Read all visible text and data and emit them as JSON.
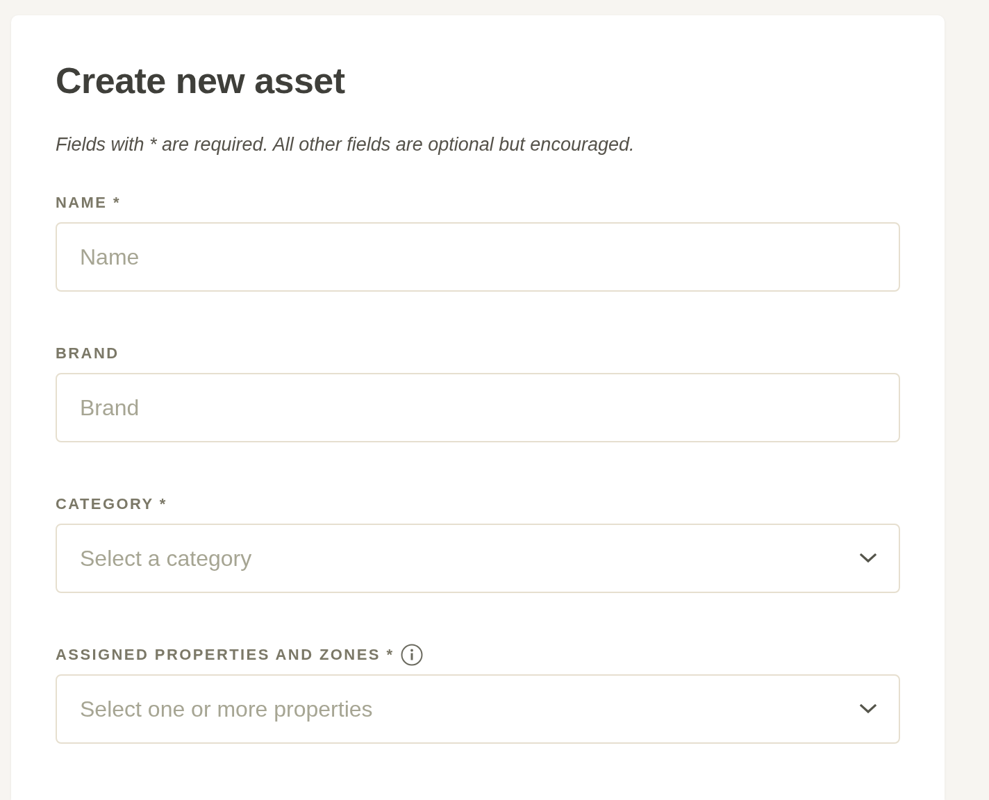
{
  "form": {
    "title": "Create new asset",
    "note": "Fields with * are required. All other fields are optional but encouraged."
  },
  "fields": [
    {
      "kind": "input",
      "label": "NAME *",
      "placeholder": "Name",
      "info": false
    },
    {
      "kind": "input",
      "label": "BRAND",
      "placeholder": "Brand",
      "info": false
    },
    {
      "kind": "select",
      "label": "CATEGORY *",
      "placeholder": "Select a category",
      "info": false
    },
    {
      "kind": "select",
      "label": "ASSIGNED PROPERTIES AND ZONES *",
      "placeholder": "Select one or more properties",
      "info": true
    }
  ]
}
